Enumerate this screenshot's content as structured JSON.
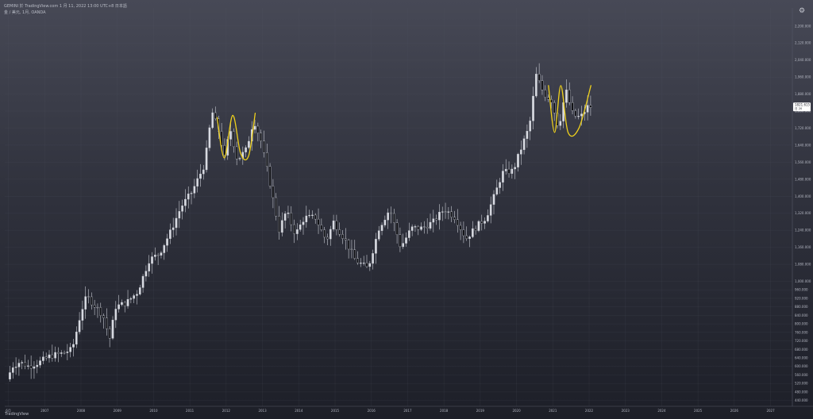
{
  "header": {
    "title_line": "GEMINI 於 TradingView.com 1 月 11, 2022 13:00 UTC+8 日本語",
    "symbol_line": "金 / 美元, 1月, OANDA"
  },
  "footer": {
    "brand": "TradingView"
  },
  "price_badge": {
    "value": "1821.615",
    "sub": "日 20"
  },
  "colors": {
    "up": "#d9dbe2",
    "down": "#0b0c10",
    "wick": "#c9ccd4",
    "annotation": "#f0d21c",
    "grid": "#5b5e6c"
  },
  "chart_data": {
    "type": "candlestick",
    "interval": "monthly",
    "instrument": "金 / 美元",
    "y_range": [
      420,
      2270
    ],
    "y_ticks": [
      "2,200.000",
      "2,120.000",
      "2,040.000",
      "1,960.000",
      "1,880.000",
      "1,800.000",
      "1,720.000",
      "1,640.000",
      "1,560.000",
      "1,480.000",
      "1,400.000",
      "1,320.000",
      "1,240.000",
      "1,160.000",
      "1,080.000",
      "1,000.000",
      "960.000",
      "920.000",
      "880.000",
      "840.000",
      "800.000",
      "760.000",
      "720.000",
      "680.000",
      "640.000",
      "600.000",
      "560.000",
      "520.000",
      "480.000",
      "440.000"
    ],
    "y_tick_values": [
      2200,
      2120,
      2040,
      1960,
      1880,
      1800,
      1720,
      1640,
      1560,
      1480,
      1400,
      1320,
      1240,
      1160,
      1080,
      1000,
      960,
      920,
      880,
      840,
      800,
      760,
      720,
      680,
      640,
      600,
      560,
      520,
      480,
      440
    ],
    "x_range": [
      2005.9,
      2027.6
    ],
    "x_ticks": [
      "6月",
      "2007",
      "2008",
      "2009",
      "2010",
      "2011",
      "2012",
      "2013",
      "2014",
      "2015",
      "2016",
      "2017",
      "2018",
      "2019",
      "2020",
      "2021",
      "2022",
      "2023",
      "2024",
      "2025",
      "2026",
      "2027"
    ],
    "x_tick_values": [
      2006.0,
      2007,
      2008,
      2009,
      2010,
      2011,
      2012,
      2013,
      2014,
      2015,
      2016,
      2017,
      2018,
      2019,
      2020,
      2021,
      2022,
      2023,
      2024,
      2025,
      2026,
      2027
    ],
    "anchors": [
      {
        "t": 2006.0,
        "p": 540
      },
      {
        "t": 2006.08,
        "p": 570
      },
      {
        "t": 2006.15,
        "p": 600
      },
      {
        "t": 2006.35,
        "p": 620
      },
      {
        "t": 2006.6,
        "p": 600
      },
      {
        "t": 2006.9,
        "p": 620
      },
      {
        "t": 2007.2,
        "p": 650
      },
      {
        "t": 2007.5,
        "p": 660
      },
      {
        "t": 2007.8,
        "p": 680
      },
      {
        "t": 2008.05,
        "p": 860
      },
      {
        "t": 2008.2,
        "p": 930
      },
      {
        "t": 2008.45,
        "p": 880
      },
      {
        "t": 2008.65,
        "p": 840
      },
      {
        "t": 2008.83,
        "p": 730
      },
      {
        "t": 2009.0,
        "p": 880
      },
      {
        "t": 2009.3,
        "p": 900
      },
      {
        "t": 2009.6,
        "p": 950
      },
      {
        "t": 2009.92,
        "p": 1100
      },
      {
        "t": 2010.2,
        "p": 1130
      },
      {
        "t": 2010.5,
        "p": 1230
      },
      {
        "t": 2010.8,
        "p": 1350
      },
      {
        "t": 2011.1,
        "p": 1420
      },
      {
        "t": 2011.45,
        "p": 1550
      },
      {
        "t": 2011.65,
        "p": 1800
      },
      {
        "t": 2011.85,
        "p": 1700
      },
      {
        "t": 2012.0,
        "p": 1580
      },
      {
        "t": 2012.15,
        "p": 1720
      },
      {
        "t": 2012.35,
        "p": 1570
      },
      {
        "t": 2012.6,
        "p": 1620
      },
      {
        "t": 2012.8,
        "p": 1760
      },
      {
        "t": 2013.0,
        "p": 1660
      },
      {
        "t": 2013.25,
        "p": 1460
      },
      {
        "t": 2013.5,
        "p": 1240
      },
      {
        "t": 2013.7,
        "p": 1330
      },
      {
        "t": 2013.95,
        "p": 1220
      },
      {
        "t": 2014.2,
        "p": 1300
      },
      {
        "t": 2014.5,
        "p": 1300
      },
      {
        "t": 2014.8,
        "p": 1190
      },
      {
        "t": 2015.0,
        "p": 1280
      },
      {
        "t": 2015.3,
        "p": 1200
      },
      {
        "t": 2015.6,
        "p": 1100
      },
      {
        "t": 2015.95,
        "p": 1060
      },
      {
        "t": 2016.25,
        "p": 1250
      },
      {
        "t": 2016.55,
        "p": 1340
      },
      {
        "t": 2016.85,
        "p": 1160
      },
      {
        "t": 2017.15,
        "p": 1250
      },
      {
        "t": 2017.45,
        "p": 1250
      },
      {
        "t": 2017.75,
        "p": 1280
      },
      {
        "t": 2018.05,
        "p": 1340
      },
      {
        "t": 2018.35,
        "p": 1300
      },
      {
        "t": 2018.65,
        "p": 1200
      },
      {
        "t": 2018.9,
        "p": 1250
      },
      {
        "t": 2019.2,
        "p": 1300
      },
      {
        "t": 2019.45,
        "p": 1410
      },
      {
        "t": 2019.65,
        "p": 1510
      },
      {
        "t": 2019.95,
        "p": 1520
      },
      {
        "t": 2020.2,
        "p": 1640
      },
      {
        "t": 2020.4,
        "p": 1730
      },
      {
        "t": 2020.58,
        "p": 1970
      },
      {
        "t": 2020.8,
        "p": 1880
      },
      {
        "t": 2021.0,
        "p": 1850
      },
      {
        "t": 2021.2,
        "p": 1720
      },
      {
        "t": 2021.4,
        "p": 1900
      },
      {
        "t": 2021.6,
        "p": 1780
      },
      {
        "t": 2021.8,
        "p": 1770
      },
      {
        "t": 2022.0,
        "p": 1820
      }
    ],
    "annotations": [
      {
        "type": "curve",
        "points": [
          [
            2011.75,
            1770
          ],
          [
            2011.95,
            1580
          ],
          [
            2012.18,
            1780
          ],
          [
            2012.4,
            1600
          ],
          [
            2012.62,
            1590
          ],
          [
            2012.8,
            1790
          ]
        ]
      },
      {
        "type": "curve",
        "points": [
          [
            2020.88,
            1920
          ],
          [
            2021.05,
            1700
          ],
          [
            2021.22,
            1920
          ],
          [
            2021.42,
            1700
          ],
          [
            2021.72,
            1720
          ],
          [
            2022.05,
            1920
          ]
        ]
      }
    ]
  }
}
